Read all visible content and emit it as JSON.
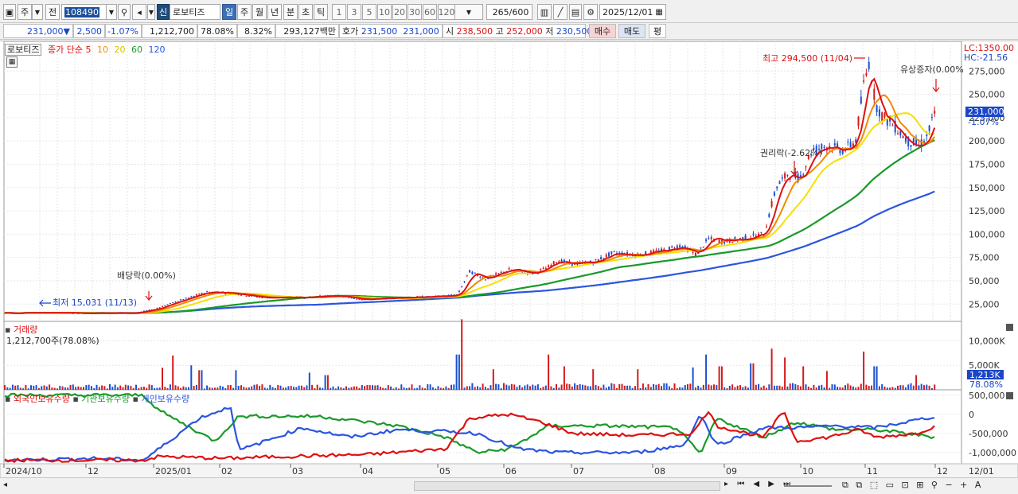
{
  "toolbar": {
    "period_main": "주",
    "prev_label": "전",
    "stock_code": "108490",
    "new_badge": "신",
    "stock_name": "로보티즈",
    "periods": [
      "일",
      "주",
      "월",
      "년",
      "분",
      "초",
      "틱"
    ],
    "intervals": [
      "1",
      "3",
      "5",
      "10",
      "20",
      "30",
      "60",
      "120"
    ],
    "count": "265",
    "count_max": "/600",
    "date": "2025/12/01"
  },
  "quote": {
    "price": "231,000▼",
    "change": "2,500",
    "change_pct": "-1.07%",
    "volume": "1,212,700",
    "turnover_pct": "78.08%",
    "ratio": "8.32%",
    "amount": "293,127백만",
    "hoga_label": "호가",
    "bid": "231,500",
    "ask": "231,000",
    "open_label": "시",
    "open": "238,500",
    "high_label": "고",
    "high": "252,000",
    "low_label": "저",
    "low": "230,500",
    "buy_label": "매수",
    "sell_label": "매도",
    "eval_label": "평"
  },
  "price_panel": {
    "stock_label": "로보티즈",
    "ma_prefix": "종가 단순",
    "ma_periods": [
      "5",
      "10",
      "20",
      "60",
      "120"
    ],
    "lc_label": "LC:1350.00",
    "hc_label": "HC:-21.56",
    "y_ticks": [
      "275,000",
      "250,000",
      "225,000",
      "200,000",
      "175,000",
      "150,000",
      "125,000",
      "100,000",
      "75,000",
      "50,000",
      "25,000"
    ],
    "current_price": "231,000",
    "current_change": "-1.07%",
    "annotations": {
      "high": "최고 294,500 (11/04)",
      "low": "최저 15,031 (11/13)",
      "dividend": "배당락(0.00%)",
      "rights": "권리락(-2.62%)",
      "capital_increase": "유상증자(0.00%"
    }
  },
  "volume_panel": {
    "title": "거래량",
    "value": "1,212,700주(78.08%)",
    "y_ticks": [
      "10,000K",
      "5,000K"
    ],
    "current": "1,213K",
    "current_pct": "78.08%"
  },
  "holdings_panel": {
    "series": [
      "외국인보유수량",
      "기관보유수량",
      "개인보유수량"
    ],
    "y_ticks": [
      "500,000",
      "0",
      "-500,000",
      "-1,000,000"
    ]
  },
  "x_axis": [
    "2024/10",
    "12",
    "2025/01",
    "02",
    "03",
    "04",
    "05",
    "06",
    "07",
    "08",
    "09",
    "10",
    "11",
    "12"
  ],
  "x_axis_right": "12/01",
  "colors": {
    "ma5": "#e01010",
    "ma10": "#f08a00",
    "ma20": "#f5e000",
    "ma60": "#1a9a2a",
    "ma120": "#2a55e0",
    "up": "#d41a1a",
    "down": "#1a4fd0",
    "foreign": "#e01010",
    "institution": "#1a9a2a",
    "individual": "#2a55e0"
  }
}
